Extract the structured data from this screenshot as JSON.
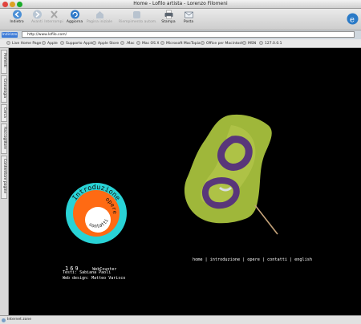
{
  "window": {
    "title": "Home - Lofilo artista - Lorenzo Filomeni"
  },
  "toolbar": {
    "items": [
      {
        "label": "Indietro",
        "icon": "back-arrow-icon"
      },
      {
        "label": "Avanti",
        "icon": "forward-arrow-icon"
      },
      {
        "label": "Interrompi",
        "icon": "stop-x-icon"
      },
      {
        "label": "Aggiorna",
        "icon": "refresh-icon"
      },
      {
        "label": "Pagina iniziale",
        "icon": "home-icon"
      },
      {
        "label": "Riempimento autom.",
        "icon": "autofill-icon"
      },
      {
        "label": "Stampa",
        "icon": "printer-icon"
      },
      {
        "label": "Posta",
        "icon": "mail-icon"
      }
    ]
  },
  "address": {
    "label": "Indirizzo",
    "url": "http://www.lofilo.com/"
  },
  "favorites": [
    "Live Home Page",
    "Apple",
    "Supporto Apple",
    "Apple Store",
    ".Mac",
    "Mac OS X",
    "Microsoft MacTopia",
    "Office per Macintosh",
    "MSN",
    "127.0.0.1"
  ],
  "sidebar": {
    "tabs": [
      "Preferiti",
      "Cronologia",
      "Cerca",
      "Raccoglitore",
      "Contenitore pagine"
    ]
  },
  "site": {
    "menu_ring": {
      "intro": "Introduzione",
      "opere": "opere",
      "contatti": "contatti"
    },
    "nav": {
      "home": "home",
      "intro": "introduzione",
      "opere": "opere",
      "contatti": "contatti",
      "english": "english",
      "separator": "|"
    },
    "counter": {
      "value": "169",
      "label": "WebCounter"
    },
    "credits": {
      "texts": "Testi: Sabiana Paoli",
      "design": "Web design: Matteo Varisco"
    }
  },
  "status": {
    "text": "Internet zone"
  },
  "colors": {
    "ring_outer": "#29d3d6",
    "ring_inner": "#ff6a13",
    "leaf": "#9fb73a",
    "leaf_dark": "#59367a",
    "address_label": "#3c7bd7"
  }
}
